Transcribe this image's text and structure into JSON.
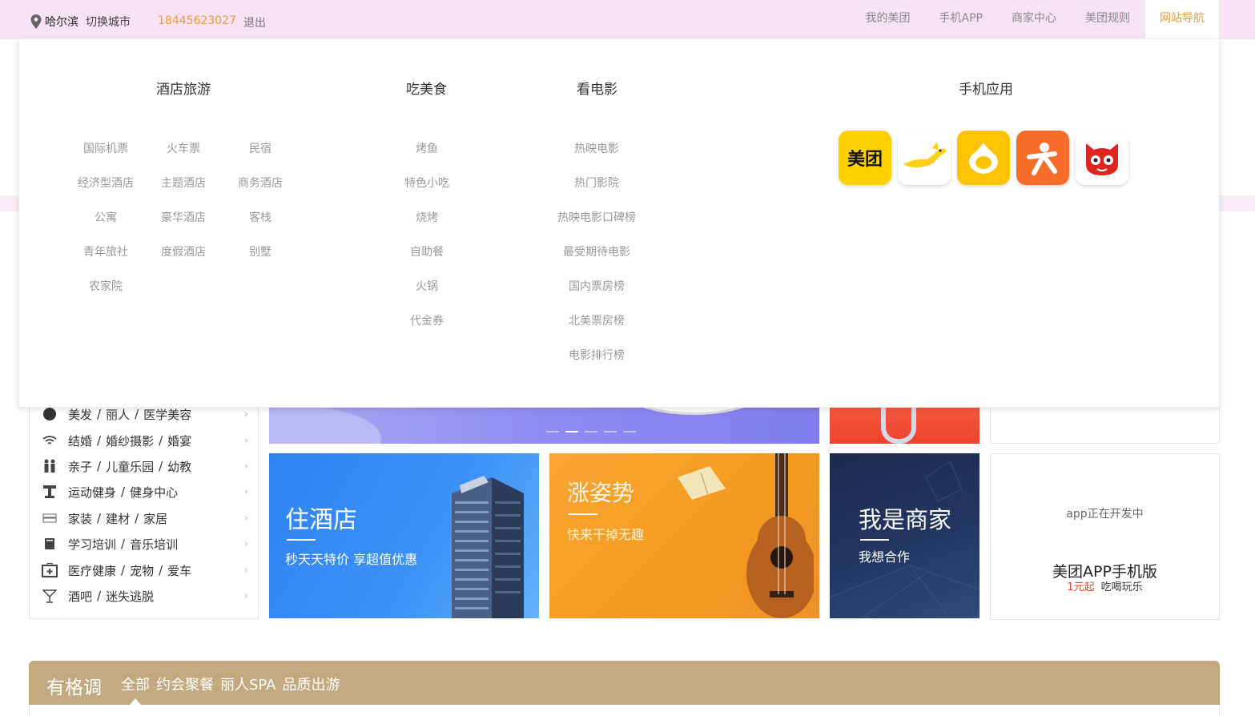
{
  "topbar": {
    "city": "哈尔滨",
    "switch_city": "切换城市",
    "phone": "18445623027",
    "logout": "退出",
    "nav": [
      {
        "label": "我的美团"
      },
      {
        "label": "手机APP"
      },
      {
        "label": "商家中心"
      },
      {
        "label": "美团规则"
      },
      {
        "label": "网站导航",
        "active": true
      }
    ]
  },
  "mega_menu": {
    "hotel_travel": {
      "title": "酒店旅游",
      "links": [
        "国际机票",
        "火车票",
        "民宿",
        "经济型酒店",
        "主题酒店",
        "商务酒店",
        "公寓",
        "豪华酒店",
        "客栈",
        "青年旅社",
        "度假酒店",
        "别墅",
        "农家院"
      ]
    },
    "food": {
      "title": "吃美食",
      "links": [
        "烤鱼",
        "特色小吃",
        "烧烤",
        "自助餐",
        "火锅",
        "代金券"
      ]
    },
    "movies": {
      "title": "看电影",
      "links": [
        "热映电影",
        "热门影院",
        "热映电影口碑榜",
        "最受期待电影",
        "国内票房榜",
        "北美票房榜",
        "电影排行榜"
      ]
    },
    "mobile_apps": {
      "title": "手机应用",
      "apps": [
        {
          "icon": "meituan-app-icon",
          "text": "美团"
        },
        {
          "icon": "kangaroo-app-icon"
        },
        {
          "icon": "yellow-drop-app-icon"
        },
        {
          "icon": "dianping-app-icon"
        },
        {
          "icon": "maoyan-cat-app-icon"
        }
      ]
    }
  },
  "categories": [
    {
      "icon": "circle-icon",
      "parts": [
        "美发",
        "丽人",
        "医学美容"
      ]
    },
    {
      "icon": "wifi-icon",
      "parts": [
        "结婚",
        "婚纱摄影",
        "婚宴"
      ]
    },
    {
      "icon": "family-icon",
      "parts": [
        "亲子",
        "儿童乐园",
        "幼教"
      ]
    },
    {
      "icon": "dumbbell-icon",
      "parts": [
        "运动健身",
        "健身中心"
      ]
    },
    {
      "icon": "sofa-icon",
      "parts": [
        "家装",
        "建材",
        "家居"
      ]
    },
    {
      "icon": "book-icon",
      "parts": [
        "学习培训",
        "音乐培训"
      ]
    },
    {
      "icon": "medical-kit-icon",
      "parts": [
        "医疗健康",
        "宠物",
        "爱车"
      ]
    },
    {
      "icon": "cocktail-icon",
      "parts": [
        "酒吧",
        "迷失逃脱"
      ]
    }
  ],
  "carousel": {
    "dots": 5,
    "active_dot": 2
  },
  "promos": {
    "hotel": {
      "title": "住酒店",
      "subtitle": "秒天天特价 享超值优惠"
    },
    "music": {
      "title": "涨姿势",
      "subtitle": "快来干掉无趣"
    },
    "merchant": {
      "title": "我是商家",
      "subtitle": "我想合作"
    },
    "app": {
      "dev_note": "app正在开发中",
      "name": "美团APP手机版",
      "price": "1元起",
      "tagline": "吃喝玩乐"
    }
  },
  "classy": {
    "title": "有格调",
    "tabs": [
      "全部",
      "约会聚餐",
      "丽人SPA",
      "品质出游"
    ]
  },
  "colors": {
    "topbar_bg": "#f7e3f3",
    "accent_orange": "#f29a38",
    "classy_bg": "#c3a97f"
  }
}
